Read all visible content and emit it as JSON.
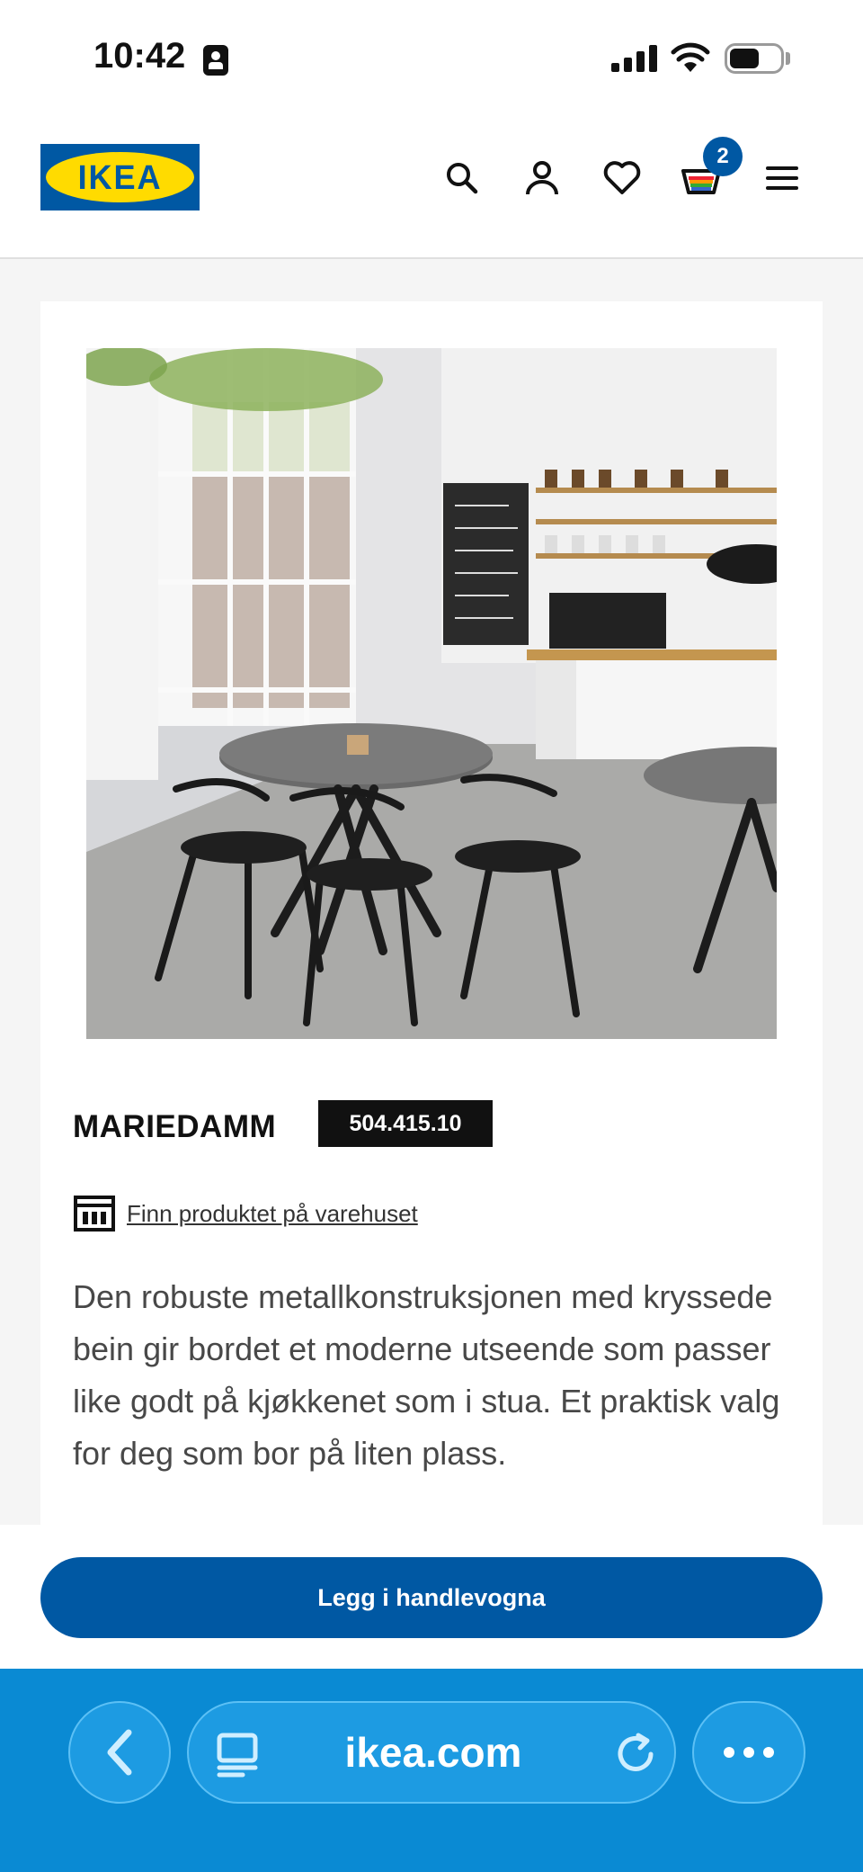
{
  "status_bar": {
    "time": "10:42",
    "battery_level": 0.6
  },
  "header": {
    "logo_text": "IKEA",
    "icons": [
      "search-icon",
      "account-icon",
      "heart-icon",
      "cart-icon",
      "menu-icon"
    ],
    "cart_count": "2"
  },
  "product": {
    "name": "MARIEDAMM",
    "article_number": "504.415.10",
    "store_link": "Finn produktet på varehuset",
    "description": "Den robuste metallkonstruksjonen med kryssede bein gir bordet et moderne utseende som passer like godt på kjøkkenet som i stua. Et praktisk valg for deg som bor på liten plass."
  },
  "actions": {
    "add_to_cart": "Legg i handlevogna"
  },
  "browser": {
    "url": "ikea.com"
  },
  "colors": {
    "brand_blue": "#0058a3",
    "brand_yellow": "#ffdb00",
    "browser_blue": "#0a8ad3"
  }
}
